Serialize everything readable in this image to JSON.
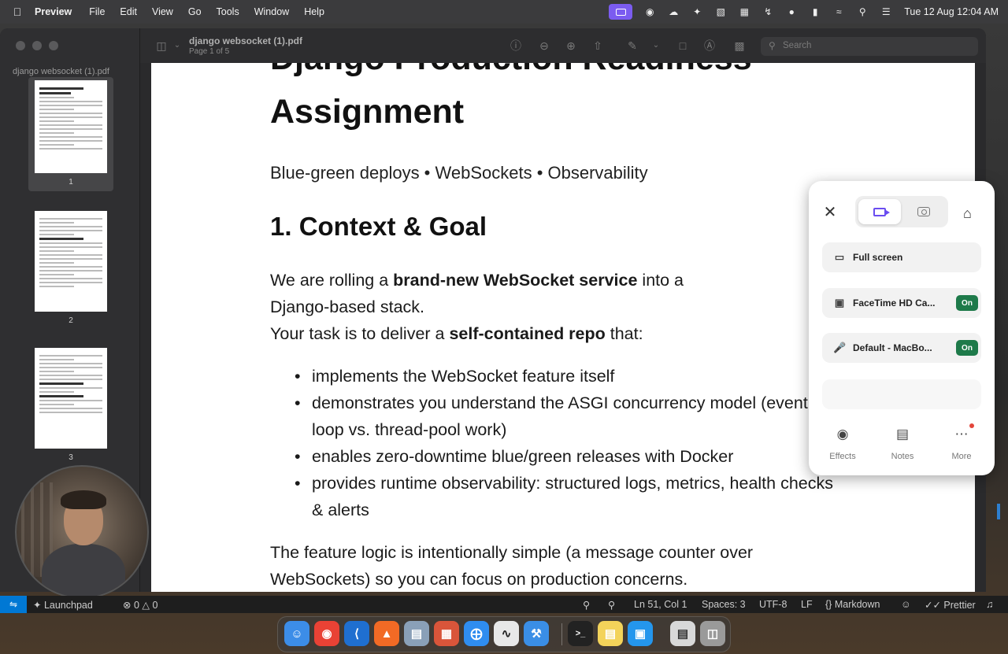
{
  "menubar": {
    "app_name": "Preview",
    "items": [
      "File",
      "Edit",
      "View",
      "Go",
      "Tools",
      "Window",
      "Help"
    ],
    "clock": "Tue 12 Aug  12:04 AM"
  },
  "window": {
    "sidebar_title": "django websocket (1).pdf",
    "doc_title": "django websocket (1).pdf",
    "doc_subtitle": "Page 1 of 5",
    "search_placeholder": "Search",
    "thumbnails": [
      {
        "page": "1"
      },
      {
        "page": "2"
      },
      {
        "page": "3"
      }
    ]
  },
  "document": {
    "heading_top": "Django Production Readiness",
    "heading": "Assignment",
    "subtitle": "Blue-green deploys • WebSockets • Observability",
    "section_title": "1. Context & Goal",
    "intro": {
      "p1_a": "We are rolling a ",
      "p1_b": "brand-new WebSocket service",
      "p1_c": " into a",
      "p1_d": "Django-based stack.",
      "p2_a": "Your task is to deliver a ",
      "p2_b": "self-contained repo",
      "p2_c": " that:"
    },
    "bullets": [
      "implements the WebSocket feature itself",
      "demonstrates you understand the ASGI concurrency model (event loop vs. thread-pool work)",
      "enables zero-downtime blue/green releases with Docker",
      "provides runtime observability: structured logs, metrics, health checks & alerts"
    ],
    "closing_a": "The feature logic is intentionally simple (a message counter over",
    "closing_b": "WebSockets) so you can focus on production concerns."
  },
  "recorder": {
    "rows": [
      {
        "label": "Full screen",
        "icon": "monitor-icon"
      },
      {
        "label": "FaceTime HD Ca...",
        "icon": "camera-icon",
        "state": "On"
      },
      {
        "label": "Default - MacBo...",
        "icon": "microphone-icon",
        "state": "On"
      }
    ],
    "actions": [
      {
        "label": "Effects",
        "icon": "palette-icon"
      },
      {
        "label": "Notes",
        "icon": "notes-icon"
      },
      {
        "label": "More",
        "icon": "more-icon"
      }
    ],
    "accent": "#6a4df0"
  },
  "statusbar": {
    "launchpad": "Launchpad",
    "errors": "0",
    "warnings": "0",
    "position": "Ln 51, Col 1",
    "spaces": "Spaces: 3",
    "encoding": "UTF-8",
    "eol": "LF",
    "language": "Markdown",
    "formatter": "Prettier"
  },
  "dock": {
    "apps": [
      "Finder",
      "Chrome",
      "VS Code",
      "Brave",
      "Preview",
      "Launchpad",
      "Safari",
      "Activity",
      "Xcode",
      "Terminal",
      "Notes",
      "Docker",
      "Archive",
      "Trash"
    ]
  }
}
